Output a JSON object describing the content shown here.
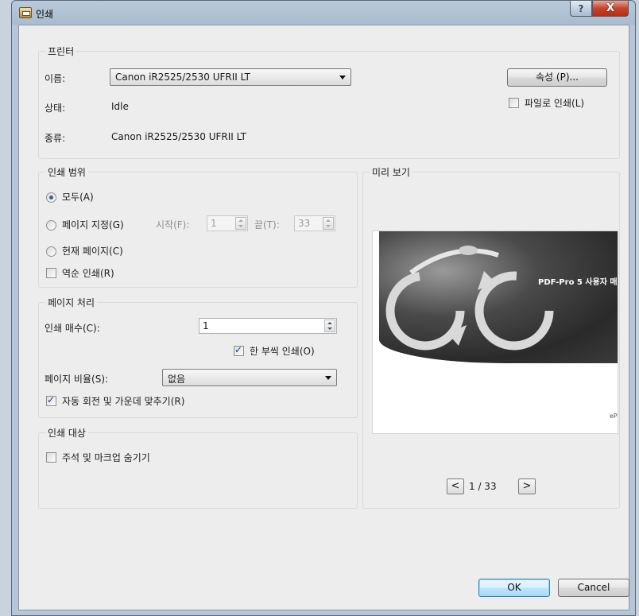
{
  "window": {
    "title": "인쇄",
    "help_label": "?",
    "close_label": "X"
  },
  "printer": {
    "legend": "프린터",
    "name_label": "이름:",
    "name_value": "Canon iR2525/2530 UFRII LT",
    "status_label": "상태:",
    "status_value": "Idle",
    "type_label": "종류:",
    "type_value": "Canon iR2525/2530 UFRII LT",
    "properties_button": "속성 (P)...",
    "print_to_file_label": "파일로 인쇄(L)",
    "print_to_file_checked": false
  },
  "range": {
    "legend": "인쇄 범위",
    "all_label": "모두(A)",
    "pages_label": "페이지 지정(G)",
    "from_label": "시작(F):",
    "from_value": "1",
    "to_label": "끝(T):",
    "to_value": "33",
    "current_label": "현재 페이지(C)",
    "reverse_label": "역순 인쇄(R)",
    "reverse_checked": false,
    "selected": "all"
  },
  "handling": {
    "legend": "페이지 처리",
    "copies_label": "인쇄 매수(C):",
    "copies_value": "1",
    "collate_label": "한 부씩 인쇄(O)",
    "collate_checked": true,
    "scale_label": "페이지 비율(S):",
    "scale_value": "없음",
    "autorotate_label": "자동 회전 및 가운데 맞추기(R)",
    "autorotate_checked": true
  },
  "target": {
    "legend": "인쇄 대상",
    "hide_markup_label": "주석 및 마크업 숨기기",
    "hide_markup_checked": false
  },
  "preview": {
    "legend": "미리 보기",
    "doc_title": "PDF-Pro 5 사용자 매",
    "brand_text": "ePr",
    "page_indicator": "1 / 33",
    "prev_label": "<",
    "next_label": ">"
  },
  "actions": {
    "ok_label": "OK",
    "cancel_label": "Cancel"
  }
}
